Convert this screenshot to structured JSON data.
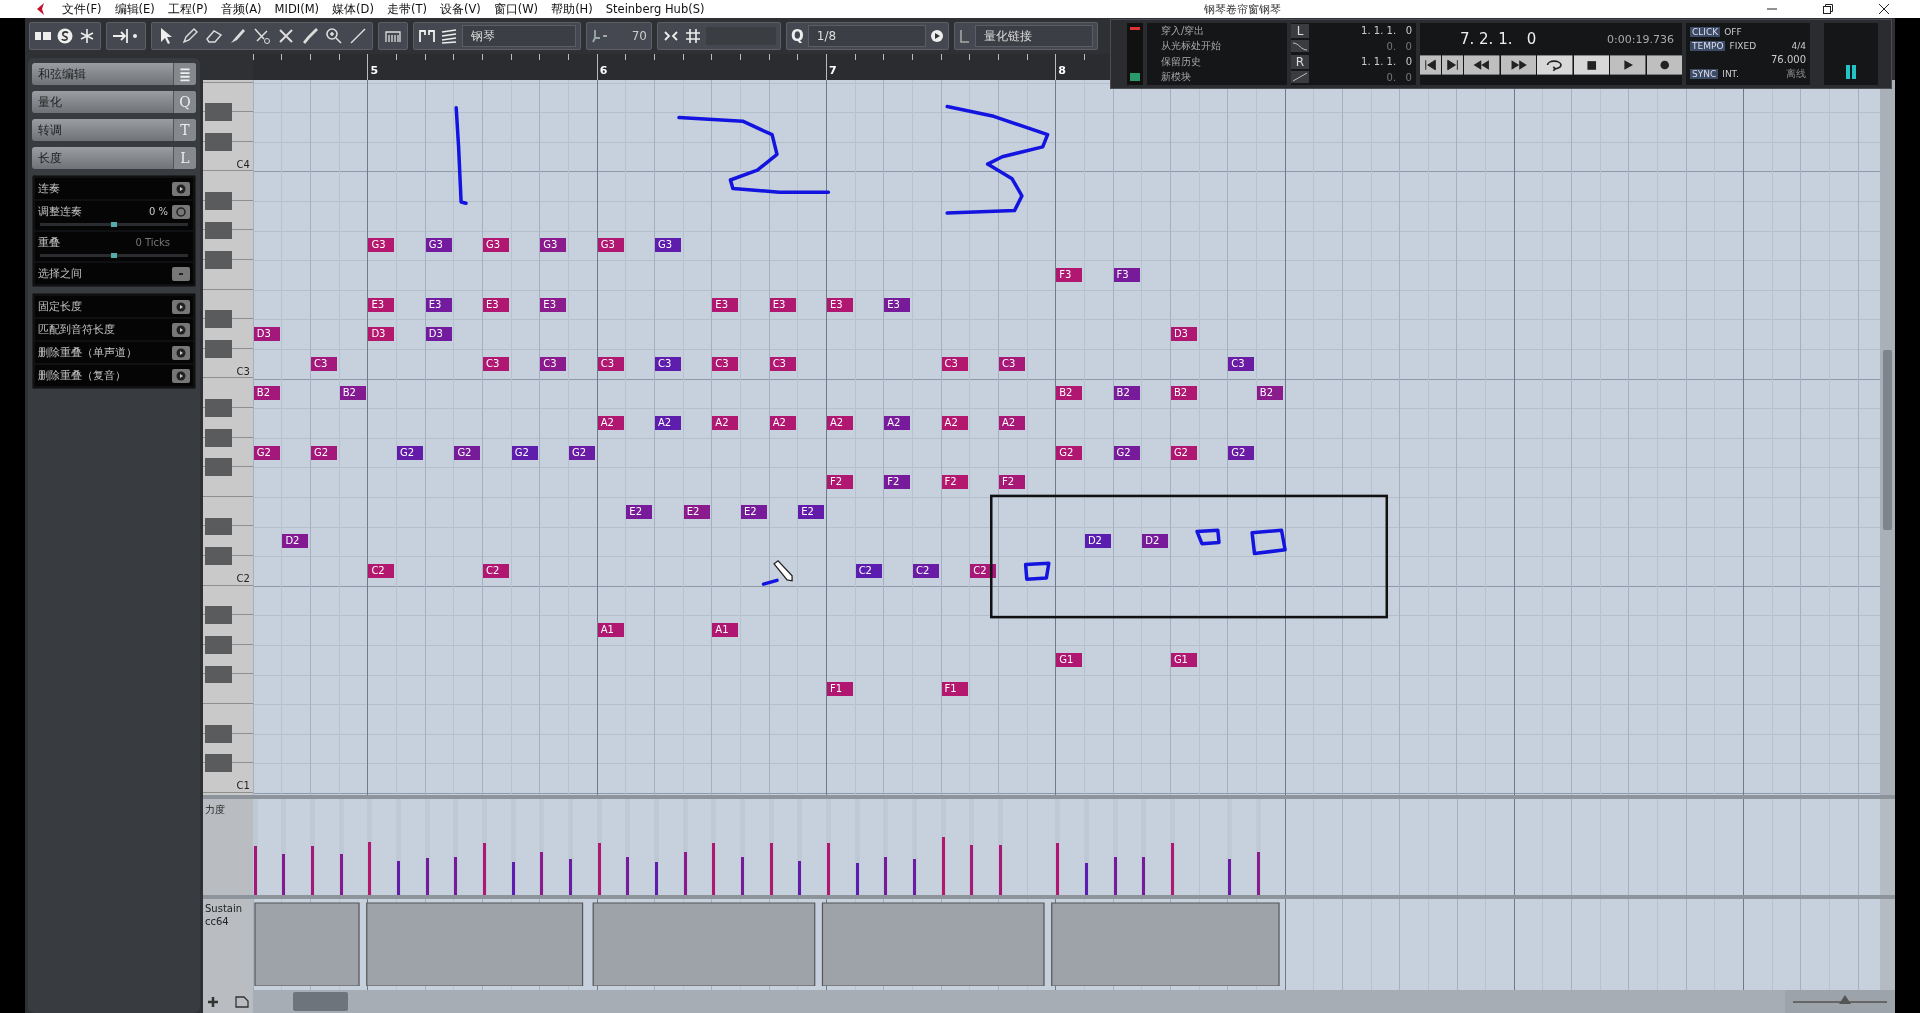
{
  "window": {
    "title": "钢琴卷帘窗钢琴"
  },
  "menu": [
    "文件(F)",
    "编辑(E)",
    "工程(P)",
    "音频(A)",
    "MIDI(M)",
    "媒体(D)",
    "走带(T)",
    "设备(V)",
    "窗口(W)",
    "帮助(H)",
    "Steinberg Hub(S)"
  ],
  "toolbar": {
    "instrument": "钢琴",
    "velocity": "70",
    "quantize_label": "Q",
    "quantize": "1/8",
    "quantize_link": "量化链接"
  },
  "inspector": {
    "sections": [
      {
        "label": "和弦编辑"
      },
      {
        "label": "量化",
        "shortcut": "Q"
      },
      {
        "label": "转调",
        "shortcut": "T"
      },
      {
        "label": "长度",
        "shortcut": "L",
        "groups": [
          [
            {
              "kind": "action",
              "label": "连奏"
            },
            {
              "kind": "slider",
              "label": "调整连奏",
              "value": "0 %",
              "level": 0.5,
              "disabled": false
            },
            {
              "kind": "slider",
              "label": "重叠",
              "value": "0 Ticks",
              "level": 0.5,
              "disabled": true
            },
            {
              "kind": "toggle",
              "label": "选择之间"
            }
          ],
          [
            {
              "kind": "action",
              "label": "固定长度"
            },
            {
              "kind": "action",
              "label": "匹配到音符长度"
            },
            {
              "kind": "action",
              "label": "删除重叠（单声道）"
            },
            {
              "kind": "action",
              "label": "删除重叠（复音）"
            }
          ]
        ]
      }
    ]
  },
  "ruler": {
    "bars": [
      "5",
      "6",
      "7",
      "8"
    ]
  },
  "keyboard": {
    "labels": [
      "C4",
      "C3",
      "C2",
      "C1"
    ]
  },
  "columns": [
    {
      "notes": [
        "D3",
        "B2",
        "G2"
      ],
      "level": 0.51
    },
    {
      "notes": [
        "D2"
      ],
      "level": 0.43
    },
    {
      "notes": [
        "C3",
        "G2"
      ],
      "level": 0.51
    },
    {
      "notes": [
        "B2"
      ],
      "level": 0.43
    },
    {
      "notes": [
        "G3",
        "E3",
        "D3",
        "C2"
      ],
      "level": 0.55
    },
    {
      "notes": [
        "G2"
      ],
      "level": 0.35
    },
    {
      "notes": [
        "G3",
        "E3",
        "D3"
      ],
      "level": 0.39
    },
    {
      "notes": [
        "G2"
      ],
      "level": 0.4
    },
    {
      "notes": [
        "G3",
        "E3",
        "C3",
        "C2"
      ],
      "level": 0.54
    },
    {
      "notes": [
        "G2"
      ],
      "level": 0.34
    },
    {
      "notes": [
        "G3",
        "E3",
        "C3"
      ],
      "level": 0.45
    },
    {
      "notes": [
        "G2"
      ],
      "level": 0.37
    },
    {
      "notes": [
        "G3",
        "C3",
        "A2",
        "A1"
      ],
      "level": 0.54
    },
    {
      "notes": [
        "E2"
      ],
      "level": 0.4
    },
    {
      "notes": [
        "G3",
        "C3",
        "A2"
      ],
      "level": 0.34
    },
    {
      "notes": [
        "E2"
      ],
      "level": 0.45
    },
    {
      "notes": [
        "E3",
        "C3",
        "A2",
        "A1"
      ],
      "level": 0.54
    },
    {
      "notes": [
        "E2"
      ],
      "level": 0.4
    },
    {
      "notes": [
        "E3",
        "C3",
        "A2"
      ],
      "level": 0.54
    },
    {
      "notes": [
        "E2"
      ],
      "level": 0.35
    },
    {
      "notes": [
        "E3",
        "A2",
        "F2",
        "F1"
      ],
      "level": 0.54
    },
    {
      "notes": [
        "C2"
      ],
      "level": 0.33
    },
    {
      "notes": [
        "E3",
        "A2",
        "F2"
      ],
      "level": 0.4
    },
    {
      "notes": [
        "C2"
      ],
      "level": 0.37
    },
    {
      "notes": [
        "C3",
        "A2",
        "F2",
        "F1"
      ],
      "level": 0.6
    },
    {
      "notes": [
        "C2"
      ],
      "level": 0.52
    },
    {
      "notes": [
        "C3",
        "A2",
        "F2"
      ],
      "level": 0.52
    },
    {},
    {
      "notes": [
        "F3",
        "B2",
        "G2",
        "G1"
      ],
      "level": 0.54
    },
    {
      "notes": [
        "D2"
      ],
      "level": 0.33
    },
    {
      "notes": [
        "F3",
        "B2",
        "G2"
      ],
      "level": 0.4
    },
    {
      "notes": [
        "D2"
      ],
      "level": 0.4
    },
    {
      "notes": [
        "D3",
        "B2",
        "G2",
        "G1"
      ],
      "level": 0.54
    },
    {},
    {
      "notes": [
        "C3",
        "G2"
      ],
      "level": 0.37
    },
    {
      "notes": [
        "B2"
      ],
      "level": 0.45
    }
  ],
  "lanes": {
    "velocity_label": "力度",
    "controller_label": "Sustain",
    "controller_number": "cc64"
  },
  "zoom": {
    "level": 0.55
  },
  "transport": {
    "punch": [
      "穿入/穿出",
      "从光标处开始",
      "保留历史",
      "新模块"
    ],
    "left_label": "L",
    "left_locator": "1. 1. 1.   0",
    "left_sub": "0.   0",
    "right_label": "R",
    "right_locator": "1. 1. 1.   0",
    "right_sub": "0.   0",
    "position": "7. 2. 1.   0",
    "time": "0:00:19.736",
    "click_label": "CLICK",
    "click_value": "OFF",
    "tempo_label": "TEMPO",
    "tempo_mode": "FIXED",
    "signature": "4/4",
    "bpm": "76.000",
    "sync_label": "SYNC",
    "sync_value": "INT.",
    "sync_status": "离线"
  }
}
